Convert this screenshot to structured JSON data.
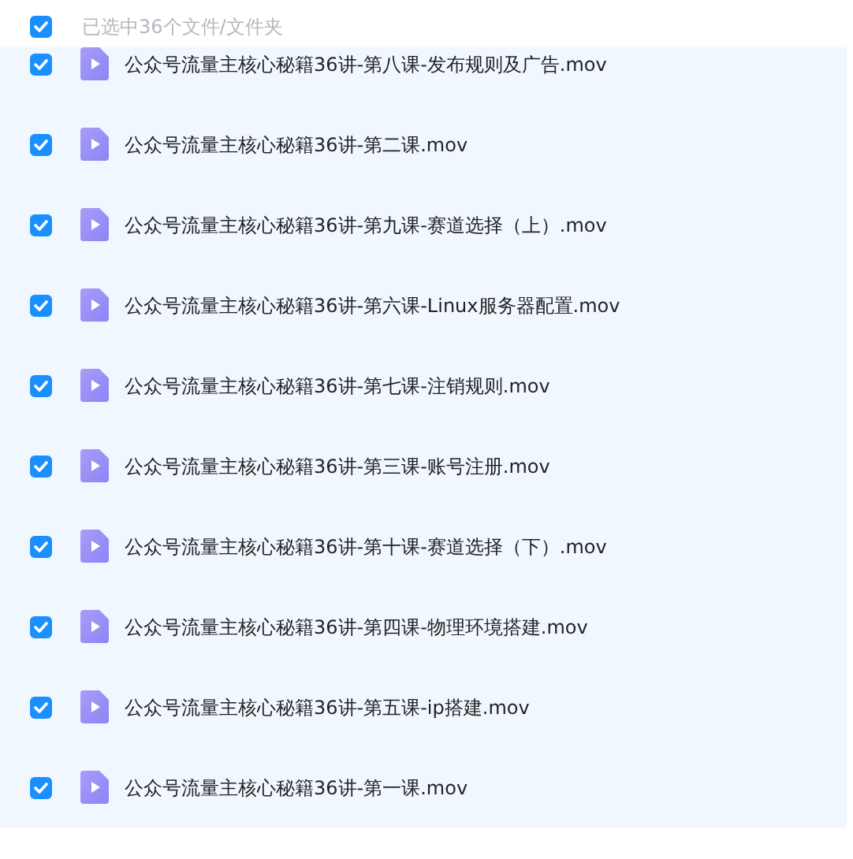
{
  "header": {
    "checked": true,
    "label": "已选中36个文件/文件夹"
  },
  "files": [
    {
      "name": "公众号流量主核心秘籍36讲-第八课-发布规则及广告.mov",
      "checked": true
    },
    {
      "name": "公众号流量主核心秘籍36讲-第二课.mov",
      "checked": true
    },
    {
      "name": "公众号流量主核心秘籍36讲-第九课-赛道选择（上）.mov",
      "checked": true
    },
    {
      "name": "公众号流量主核心秘籍36讲-第六课-Linux服务器配置.mov",
      "checked": true
    },
    {
      "name": "公众号流量主核心秘籍36讲-第七课-注销规则.mov",
      "checked": true
    },
    {
      "name": "公众号流量主核心秘籍36讲-第三课-账号注册.mov",
      "checked": true
    },
    {
      "name": "公众号流量主核心秘籍36讲-第十课-赛道选择（下）.mov",
      "checked": true
    },
    {
      "name": "公众号流量主核心秘籍36讲-第四课-物理环境搭建.mov",
      "checked": true
    },
    {
      "name": "公众号流量主核心秘籍36讲-第五课-ip搭建.mov",
      "checked": true
    },
    {
      "name": "公众号流量主核心秘籍36讲-第一课.mov",
      "checked": true
    }
  ]
}
